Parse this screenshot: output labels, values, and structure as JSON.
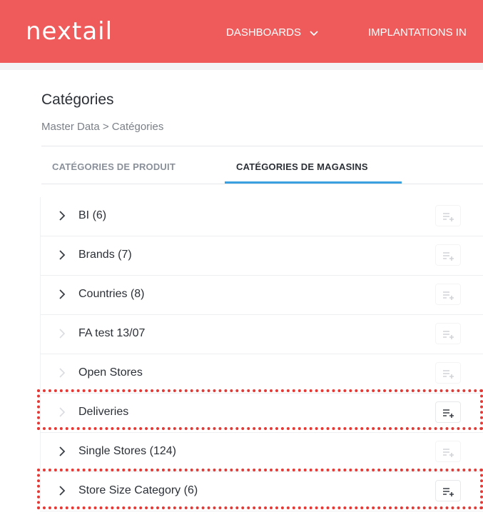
{
  "header": {
    "logo": "nextail",
    "nav": [
      {
        "label": "DASHBOARDS",
        "has_dropdown": true
      },
      {
        "label": "IMPLANTATIONS IN"
      }
    ],
    "accent_color": "#ef5a5a"
  },
  "page": {
    "title": "Catégories",
    "breadcrumb": "Master Data > Catégories"
  },
  "tabs": [
    {
      "label": "CATÉGORIES DE PRODUIT",
      "active": false
    },
    {
      "label": "CATÉGORIES DE MAGASINS",
      "active": true
    }
  ],
  "rows": [
    {
      "label": "BI (6)",
      "expandable": true
    },
    {
      "label": "Brands (7)",
      "expandable": true
    },
    {
      "label": "Countries (8)",
      "expandable": true
    },
    {
      "label": "FA test 13/07",
      "expandable": false
    },
    {
      "label": "Open Stores",
      "expandable": false
    },
    {
      "label": "Deliveries",
      "expandable": false,
      "highlighted": true
    },
    {
      "label": "Single Stores (124)",
      "expandable": true
    },
    {
      "label": "Store Size Category (6)",
      "expandable": true,
      "highlighted": true
    }
  ],
  "icons": {
    "row_toggle": "chevron-right-icon",
    "row_action": "add-subcategory-icon",
    "nav_dropdown": "chevron-down-icon"
  }
}
